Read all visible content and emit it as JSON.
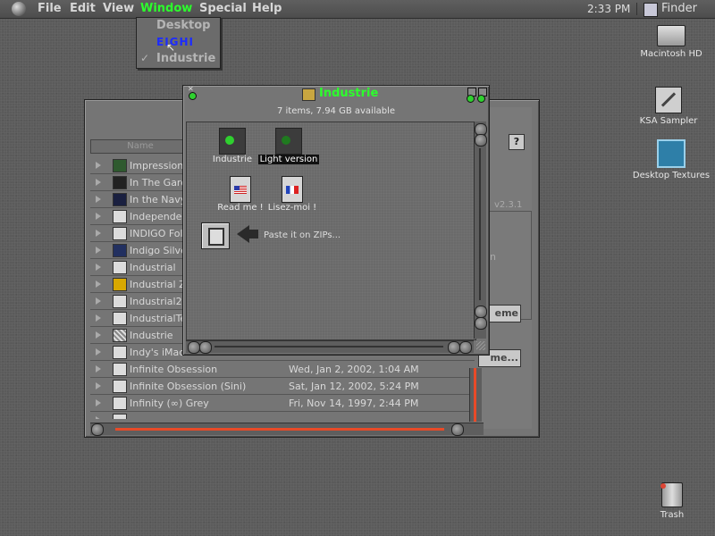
{
  "menubar": {
    "menus": [
      "File",
      "Edit",
      "View",
      "Window",
      "Special",
      "Help"
    ],
    "clock": "2:33 PM",
    "app": "Finder"
  },
  "window_menu": {
    "items": [
      "Desktop",
      "EIGHI",
      "Industrie"
    ],
    "checked": "Industrie"
  },
  "back_window": {
    "column_header": "Name",
    "version": "v2.3.1",
    "help_label": "?",
    "partial_button_1": "eme",
    "partial_button_2": "me...",
    "partial_field": "n",
    "rows": [
      {
        "name": "Impressionis",
        "date": ""
      },
      {
        "name": "In The Garden",
        "date": ""
      },
      {
        "name": "In the Navy 1",
        "date": ""
      },
      {
        "name": "Independence",
        "date": ""
      },
      {
        "name": "INDIGO Folde",
        "date": ""
      },
      {
        "name": "Indigo Silver",
        "date": ""
      },
      {
        "name": "Industrial",
        "date": ""
      },
      {
        "name": "Industrial Zo",
        "date": ""
      },
      {
        "name": "Industrial2",
        "date": ""
      },
      {
        "name": "IndustrialTec",
        "date": ""
      },
      {
        "name": "Industrie",
        "date": ""
      },
      {
        "name": "Indy's iMac f",
        "date": ""
      },
      {
        "name": "Infinite Obsession",
        "date": "Wed, Jan 2, 2002, 1:04 AM"
      },
      {
        "name": "Infinite Obsession (Sini)",
        "date": "Sat, Jan 12, 2002, 5:24 PM"
      },
      {
        "name": "Infinity (∞) Grey",
        "date": "Fri, Nov 14, 1997, 2:44 PM"
      },
      {
        "name": "",
        "date": ""
      }
    ]
  },
  "front_window": {
    "title": "Industrie",
    "info": "7 items, 7.94 GB available",
    "items": [
      {
        "label": "Industrie"
      },
      {
        "label": "Light version"
      },
      {
        "label": "Read me !"
      },
      {
        "label": "Lisez-moi !"
      }
    ],
    "paste_hint": "Paste it on ZIPs..."
  },
  "desktop": {
    "icons": [
      {
        "label": "Macintosh HD"
      },
      {
        "label": "KSA Sampler"
      },
      {
        "label": "Desktop Textures"
      },
      {
        "label": "Trash"
      }
    ]
  },
  "colors": {
    "accent": "#2cff2c",
    "highlight": "#e84a28"
  }
}
